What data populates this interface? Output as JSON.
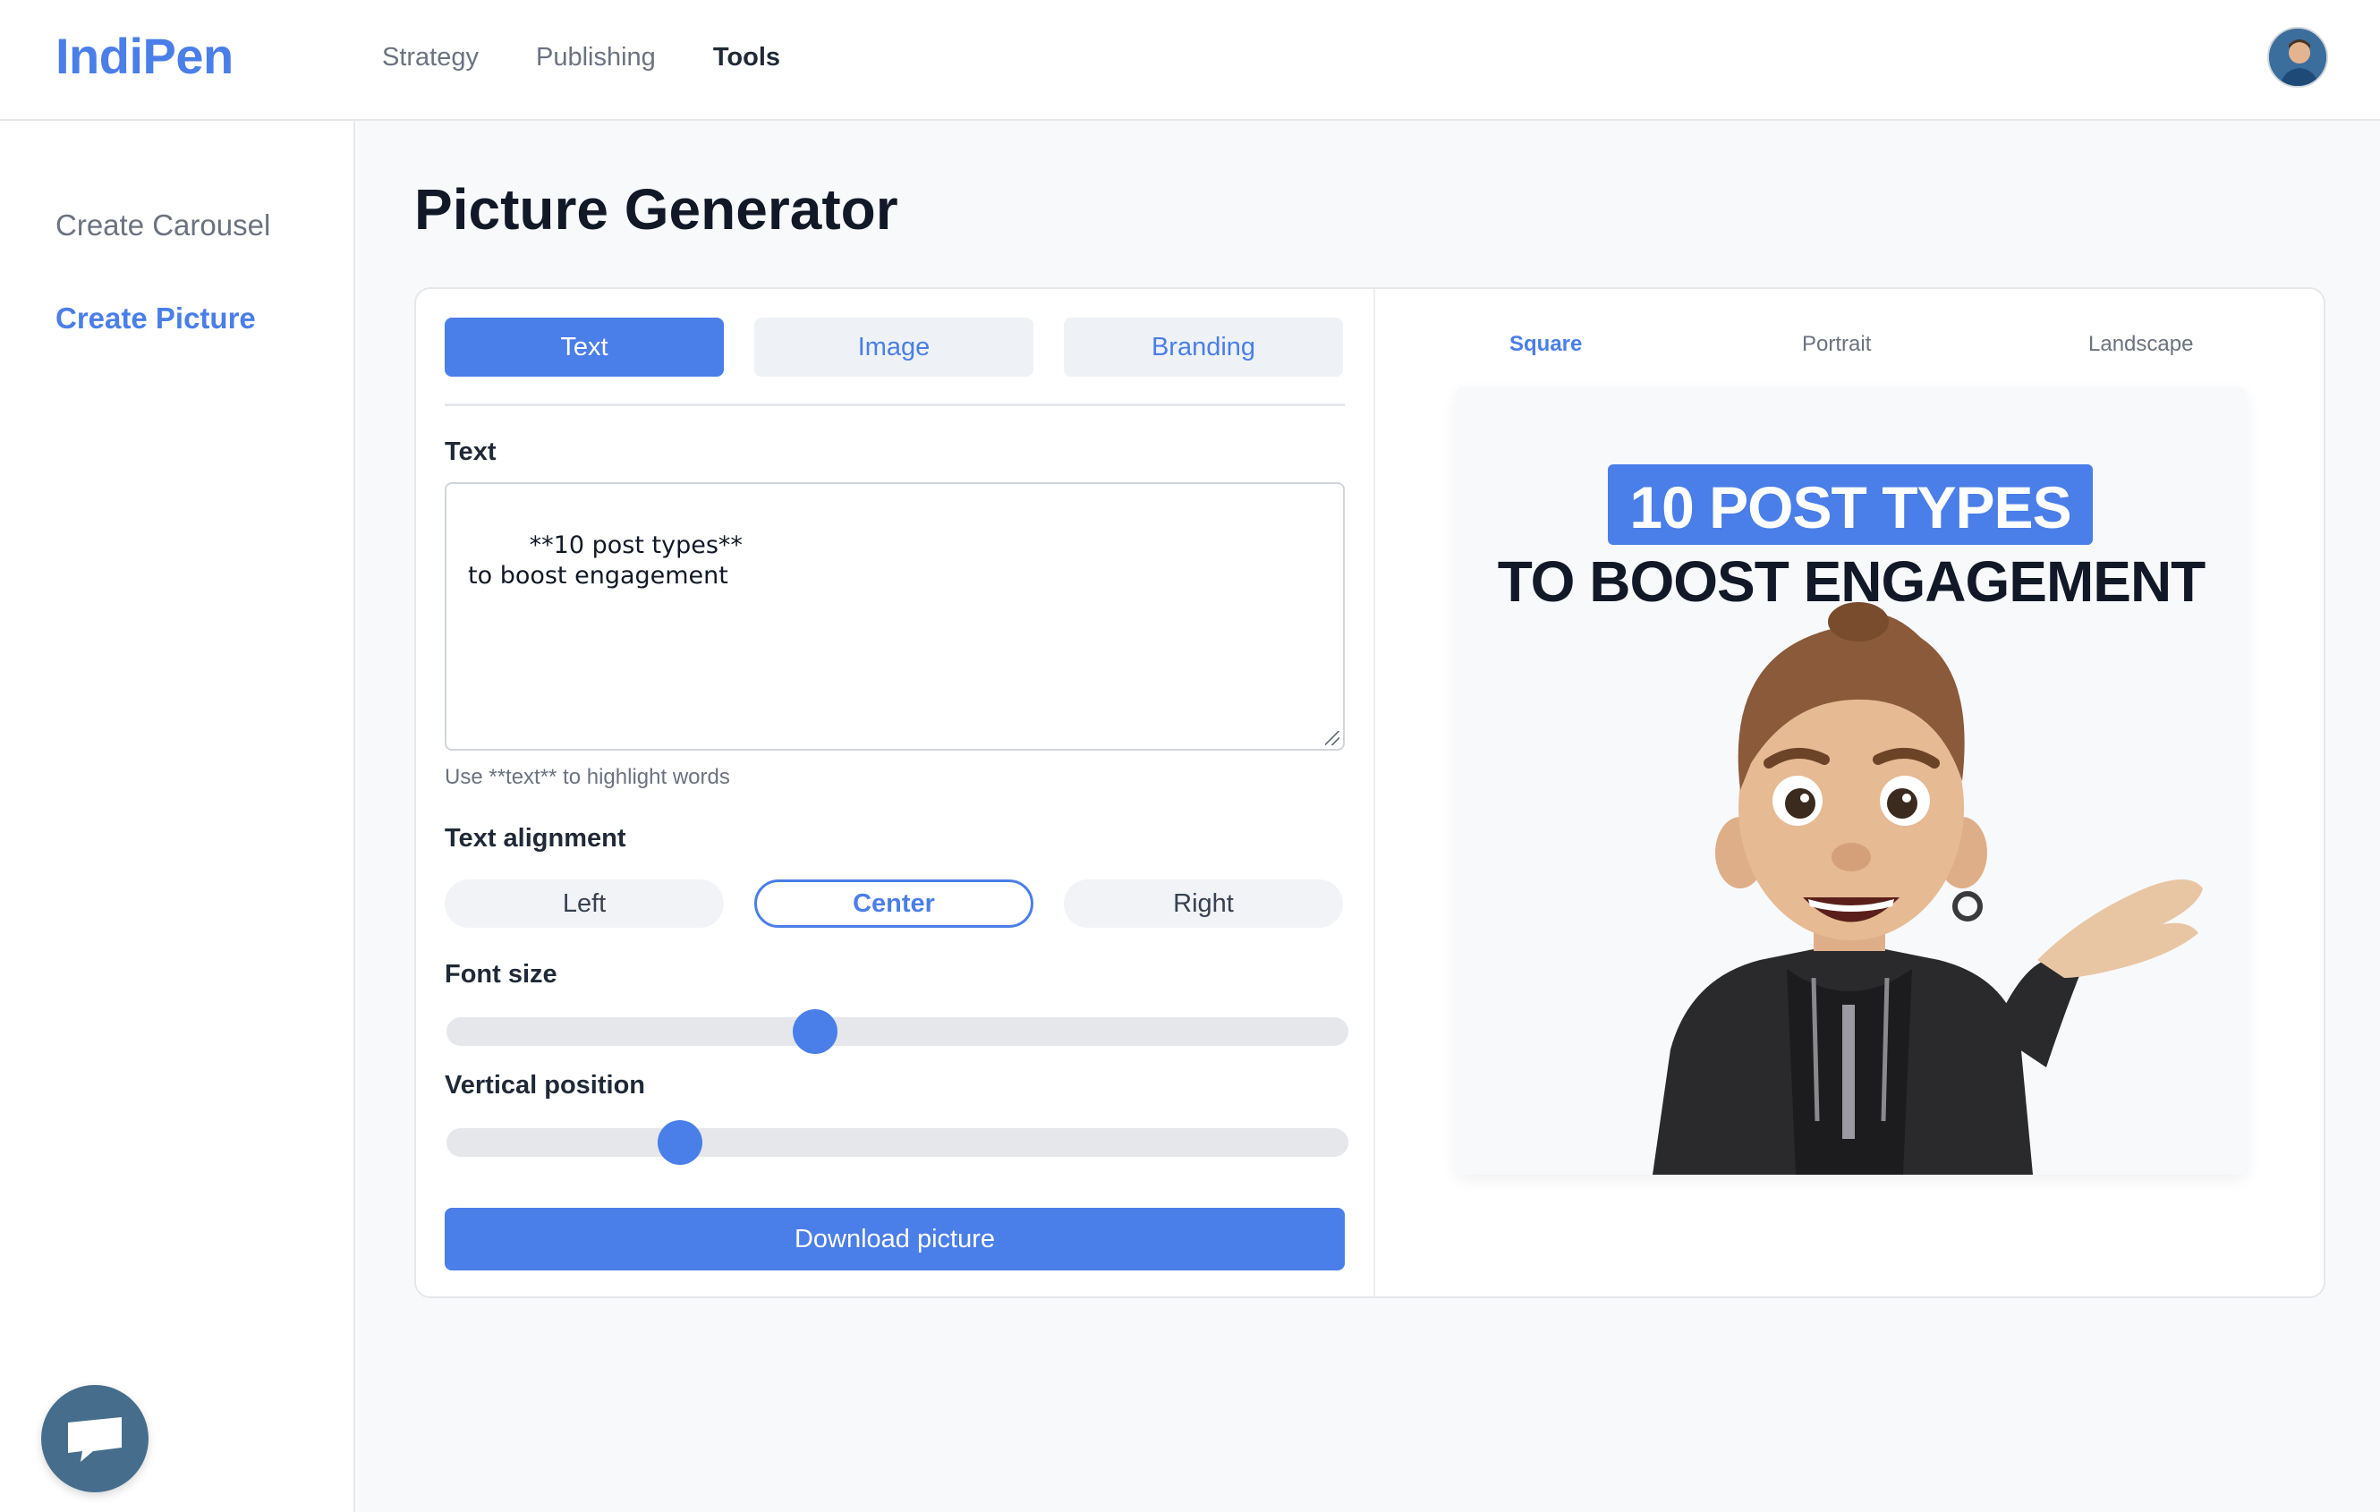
{
  "header": {
    "logo": "IndiPen",
    "nav": [
      {
        "label": "Strategy",
        "active": false
      },
      {
        "label": "Publishing",
        "active": false
      },
      {
        "label": "Tools",
        "active": true
      }
    ],
    "avatar_icon": "user-avatar"
  },
  "sidebar": {
    "items": [
      {
        "label": "Create Carousel",
        "active": false
      },
      {
        "label": "Create Picture",
        "active": true
      }
    ],
    "chat_icon": "chat-bubble-icon"
  },
  "main": {
    "title": "Picture Generator",
    "tabs": [
      {
        "label": "Text",
        "active": true
      },
      {
        "label": "Image",
        "active": false
      },
      {
        "label": "Branding",
        "active": false
      }
    ],
    "text_label": "Text",
    "text_value": "**10 post types**\nto boost engagement",
    "text_hint": "Use **text** to highlight words",
    "alignment_label": "Text alignment",
    "alignment_options": [
      {
        "label": "Left",
        "active": false
      },
      {
        "label": "Center",
        "active": true
      },
      {
        "label": "Right",
        "active": false
      }
    ],
    "font_size_label": "Font size",
    "font_size_value": 0.41,
    "vertical_position_label": "Vertical position",
    "vertical_position_value": 0.26,
    "download_label": "Download picture"
  },
  "preview": {
    "formats": [
      {
        "label": "Square",
        "active": true
      },
      {
        "label": "Portrait",
        "active": false
      },
      {
        "label": "Landscape",
        "active": false
      }
    ],
    "headline_highlight": "10 POST TYPES",
    "headline_rest": "TO BOOST ENGAGEMENT",
    "image_subject": "memoji-presenter-illustration"
  },
  "colors": {
    "accent": "#4a7ee8",
    "text_dark": "#111827",
    "muted": "#6b7280",
    "chat_bubble": "#466e8c"
  }
}
